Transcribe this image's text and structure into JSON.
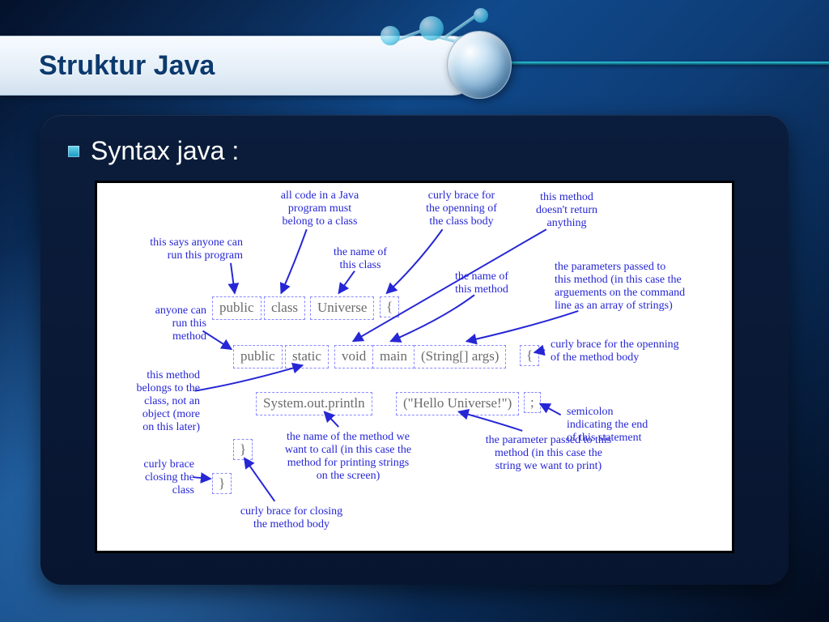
{
  "header": {
    "title": "Struktur Java"
  },
  "bullet": {
    "text": "Syntax java :"
  },
  "tokens": {
    "row1": {
      "public": "public",
      "class": "class",
      "universe": "Universe",
      "lbrace": "{"
    },
    "row2": {
      "public": "public",
      "static": "static",
      "void": "void",
      "main": "main",
      "params": "(String[] args)",
      "lbrace": "{"
    },
    "row3": {
      "println": "System.out.println",
      "arg": "(\"Hello Universe!\")",
      "semi": ";"
    },
    "closeMethod": "}",
    "closeClass": "}"
  },
  "annotations": {
    "allCodeInClass": "all code in a Java\nprogram must\nbelong to a class",
    "anyoneRunProgram": "this says anyone can\nrun this program",
    "nameOfClass": "the name of\nthis class",
    "openClassBody": "curly brace for\nthe openning of\nthe class body",
    "voidNoReturn": "this method\ndoesn't return\nanything",
    "anyoneRunMethod": "anyone can\nrun this\nmethod",
    "nameOfMethod": "the name of\nthis method",
    "paramsPassed": "the parameters passed to\nthis method (in this case the\narguements on the command\nline as an array of strings)",
    "openMethodBody": "curly brace for the openning\nof the method body",
    "belongsToClass": "this method\nbelongs to the\nclass, not an\nobject (more\non this later)",
    "closeClassBrace": "curly brace\nclosing the\nclass",
    "closeMethodBrace": "curly brace for closing\nthe method body",
    "printlnExplain": "the name of the method we\nwant to call (in this case the\nmethod for printing strings\non the screen)",
    "helloParam": "the parameter passed to this\nmethod (in this case the\nstring we want to print)",
    "semicolon": "semicolon\nindicating the end\nof this statement"
  }
}
